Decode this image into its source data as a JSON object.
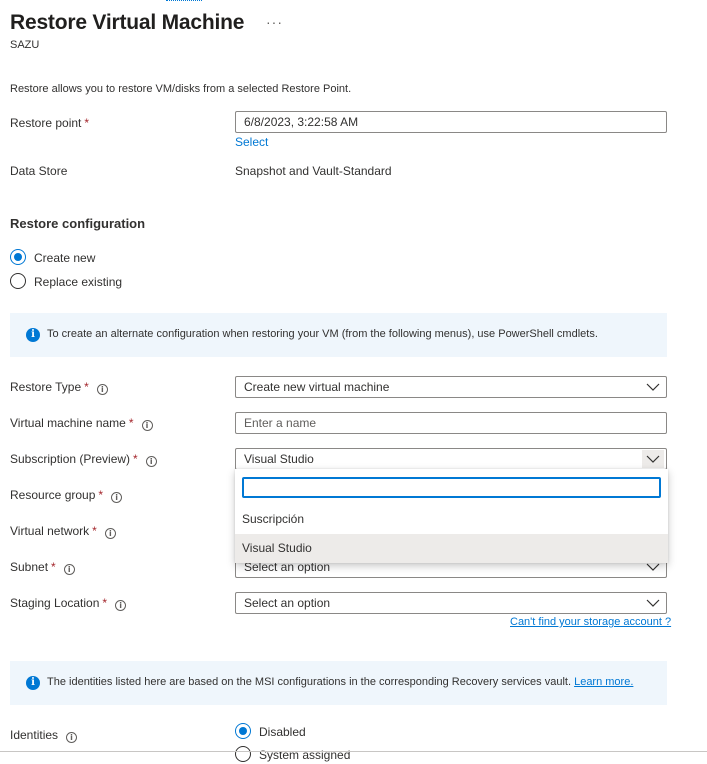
{
  "header": {
    "title": "Restore Virtual Machine",
    "more_label": "···",
    "subtitle": "SAZU"
  },
  "intro": "Restore allows you to restore VM/disks from a selected Restore Point.",
  "restore_point": {
    "label": "Restore point",
    "required_mark": "*",
    "value": "6/8/2023, 3:22:58 AM",
    "select_link": "Select"
  },
  "data_store": {
    "label": "Data Store",
    "value": "Snapshot and Vault-Standard"
  },
  "restore_config": {
    "heading": "Restore configuration",
    "options": [
      {
        "label": "Create new",
        "selected": true
      },
      {
        "label": "Replace existing",
        "selected": false
      }
    ]
  },
  "info_banner_1": {
    "icon": "info-icon",
    "text": "To create an alternate configuration when restoring your VM (from the following menus), use PowerShell cmdlets."
  },
  "form": {
    "required_mark": "*",
    "restore_type": {
      "label": "Restore Type",
      "value": "Create new virtual machine"
    },
    "vm_name": {
      "label": "Virtual machine name",
      "placeholder": "Enter a name"
    },
    "subscription": {
      "label": "Subscription (Preview)",
      "value": "Visual Studio"
    },
    "resource_group": {
      "label": "Resource group"
    },
    "virtual_network": {
      "label": "Virtual network"
    },
    "subnet": {
      "label": "Subnet",
      "value": "Select an option"
    },
    "staging_location": {
      "label": "Staging Location",
      "value": "Select an option",
      "link": "Can't find your storage account ?"
    }
  },
  "subscription_dropdown": {
    "search_value": "",
    "options": [
      {
        "label": "Suscripción",
        "selected": false
      },
      {
        "label": "Visual Studio",
        "selected": true
      }
    ]
  },
  "info_banner_2": {
    "icon": "info-icon",
    "text": "The identities listed here are based on the MSI configurations in the corresponding Recovery services vault.",
    "link": "Learn more."
  },
  "identities": {
    "label": "Identities",
    "options": [
      {
        "label": "Disabled",
        "selected": true
      },
      {
        "label": "System assigned",
        "selected": false
      }
    ]
  },
  "colors": {
    "accent": "#0078d4",
    "required": "#a4262c",
    "banner_bg": "#eff6fc",
    "selected_option_bg": "#edebe9"
  }
}
